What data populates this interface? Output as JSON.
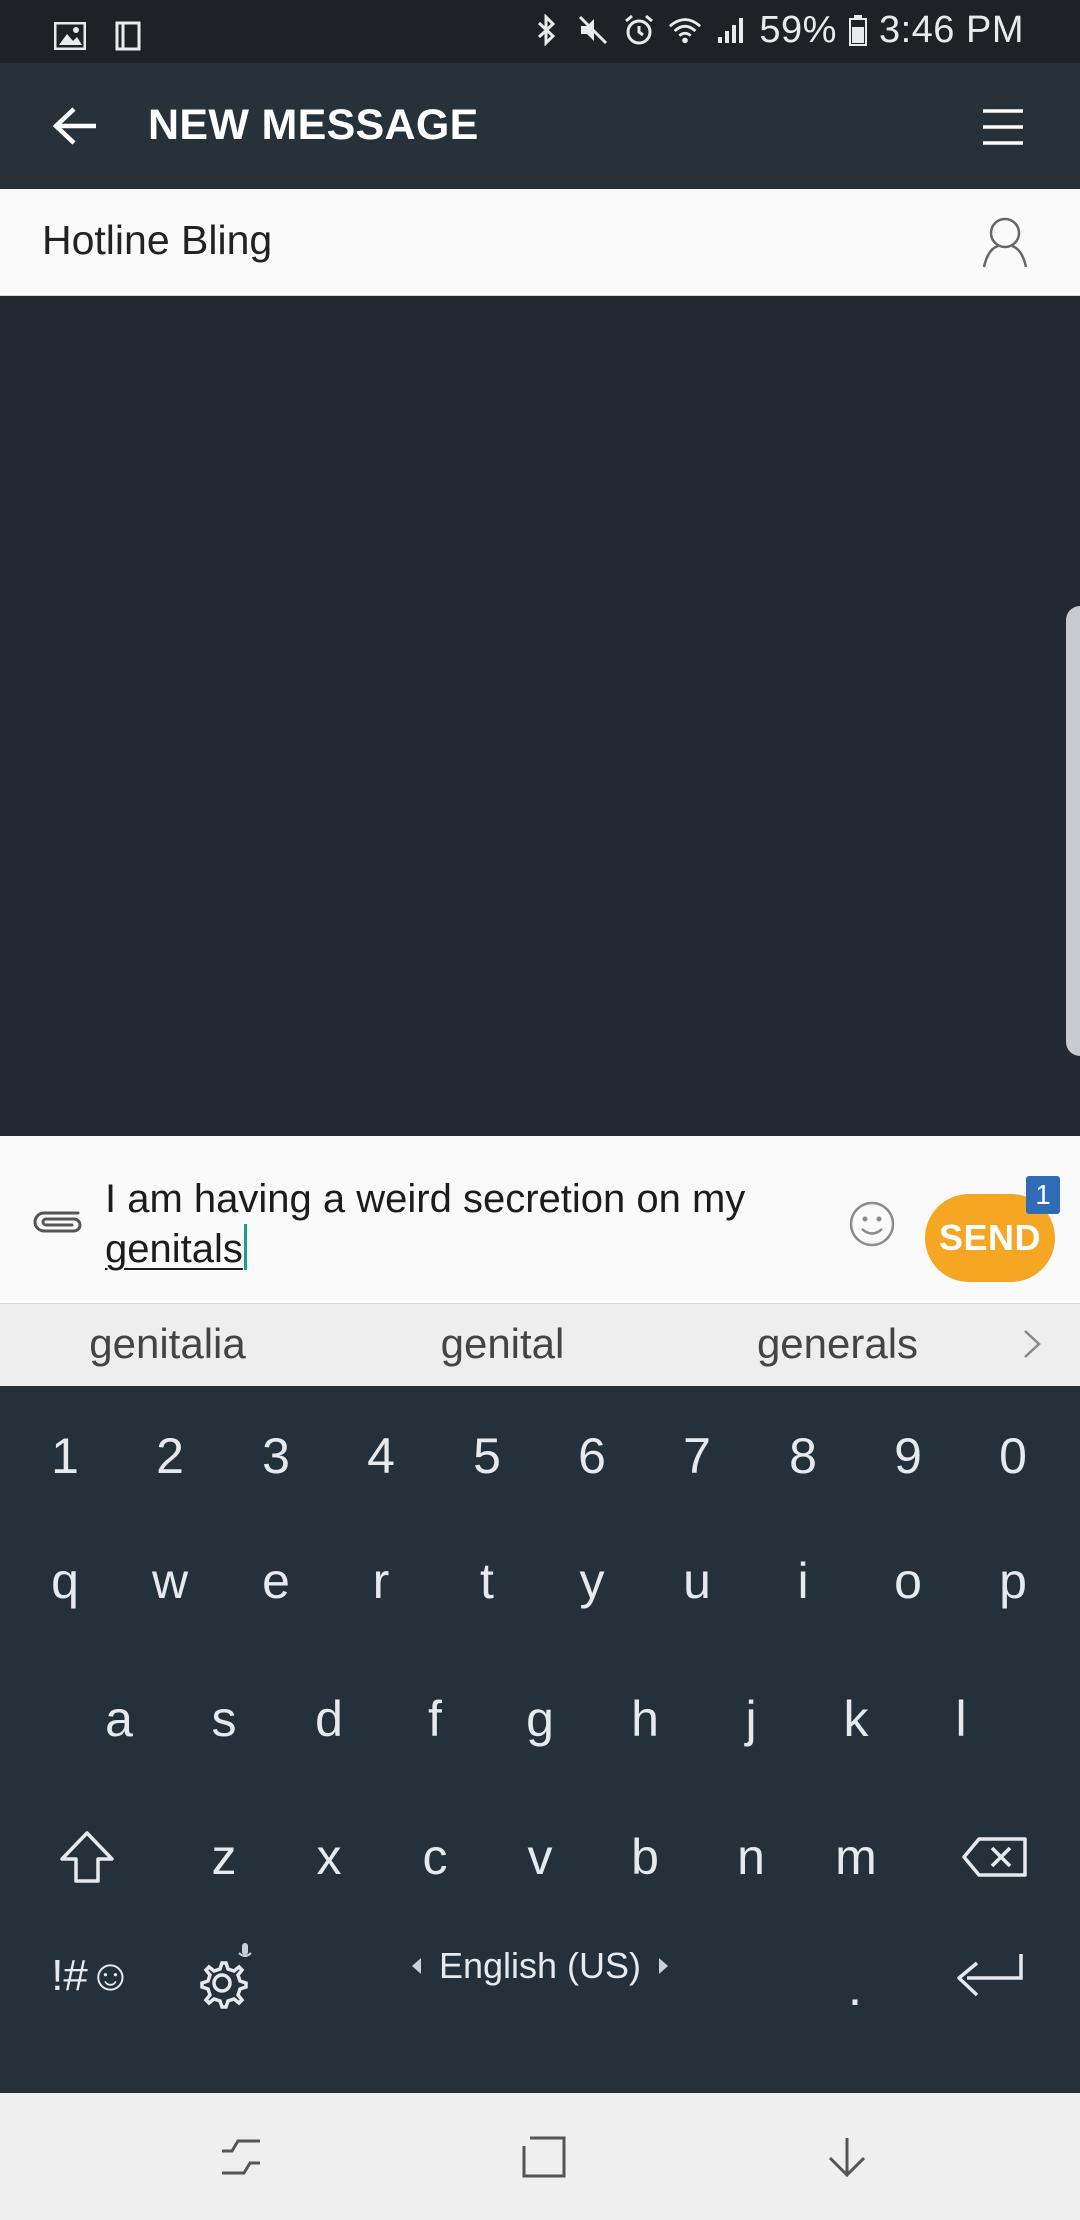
{
  "status_bar": {
    "battery": "59%",
    "time": "3:46 PM"
  },
  "app_bar": {
    "title": "NEW MESSAGE"
  },
  "recipient": {
    "name": "Hotline Bling"
  },
  "compose": {
    "text_before": "I am having a weird secretion on my ",
    "text_underlined": "genitals",
    "send_label": "SEND",
    "send_badge": "1"
  },
  "suggestions": [
    "genitalia",
    "genital",
    "generals"
  ],
  "keyboard": {
    "numbers": [
      "1",
      "2",
      "3",
      "4",
      "5",
      "6",
      "7",
      "8",
      "9",
      "0"
    ],
    "row1": [
      "q",
      "w",
      "e",
      "r",
      "t",
      "y",
      "u",
      "i",
      "o",
      "p"
    ],
    "row2": [
      "a",
      "s",
      "d",
      "f",
      "g",
      "h",
      "j",
      "k",
      "l"
    ],
    "row3": [
      "z",
      "x",
      "c",
      "v",
      "b",
      "n",
      "m"
    ],
    "symbols_label": "!#☺",
    "language": "English (US)",
    "period": "."
  },
  "colors": {
    "accent_send": "#f5a623",
    "badge": "#2f6cb5",
    "cursor": "#19a08a"
  }
}
